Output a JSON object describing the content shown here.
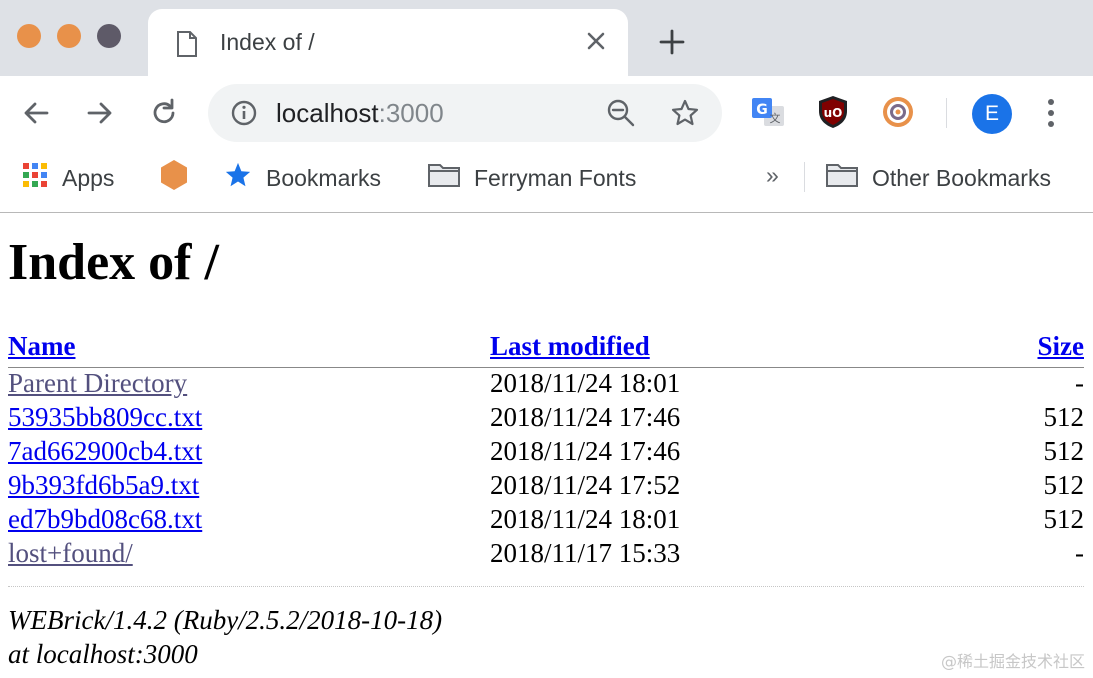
{
  "browser": {
    "tab": {
      "title": "Index of /"
    },
    "address_bar": {
      "host": "localhost",
      "port": ":3000"
    },
    "profile": {
      "initial": "E",
      "color": "#1a73e8"
    },
    "bookmarks": {
      "apps": "Apps",
      "bookmarks": "Bookmarks",
      "ferryman": "Ferryman Fonts",
      "more": "»",
      "other": "Other Bookmarks"
    },
    "icons": [
      "back-icon",
      "forward-icon",
      "reload-icon",
      "info-icon",
      "zoom-out-icon",
      "star-icon",
      "translate-icon",
      "ublock-icon",
      "target-icon",
      "menu-icon"
    ]
  },
  "page": {
    "heading": "Index of /",
    "columns": {
      "name": "Name",
      "modified": "Last modified",
      "size": "Size"
    },
    "rows": [
      {
        "name": "Parent Directory",
        "modified": "2018/11/24 18:01",
        "size": "-"
      },
      {
        "name": "53935bb809cc.txt",
        "modified": "2018/11/24 17:46",
        "size": "512"
      },
      {
        "name": "7ad662900cb4.txt",
        "modified": "2018/11/24 17:46",
        "size": "512"
      },
      {
        "name": "9b393fd6b5a9.txt",
        "modified": "2018/11/24 17:52",
        "size": "512"
      },
      {
        "name": "ed7b9bd08c68.txt",
        "modified": "2018/11/24 18:01",
        "size": "512"
      },
      {
        "name": "lost+found/",
        "modified": "2018/11/17 15:33",
        "size": "-"
      }
    ],
    "footer": {
      "line1": "WEBrick/1.4.2 (Ruby/2.5.2/2018-10-18)",
      "line2": "at localhost:3000"
    }
  },
  "watermark": "@稀土掘金技术社区"
}
